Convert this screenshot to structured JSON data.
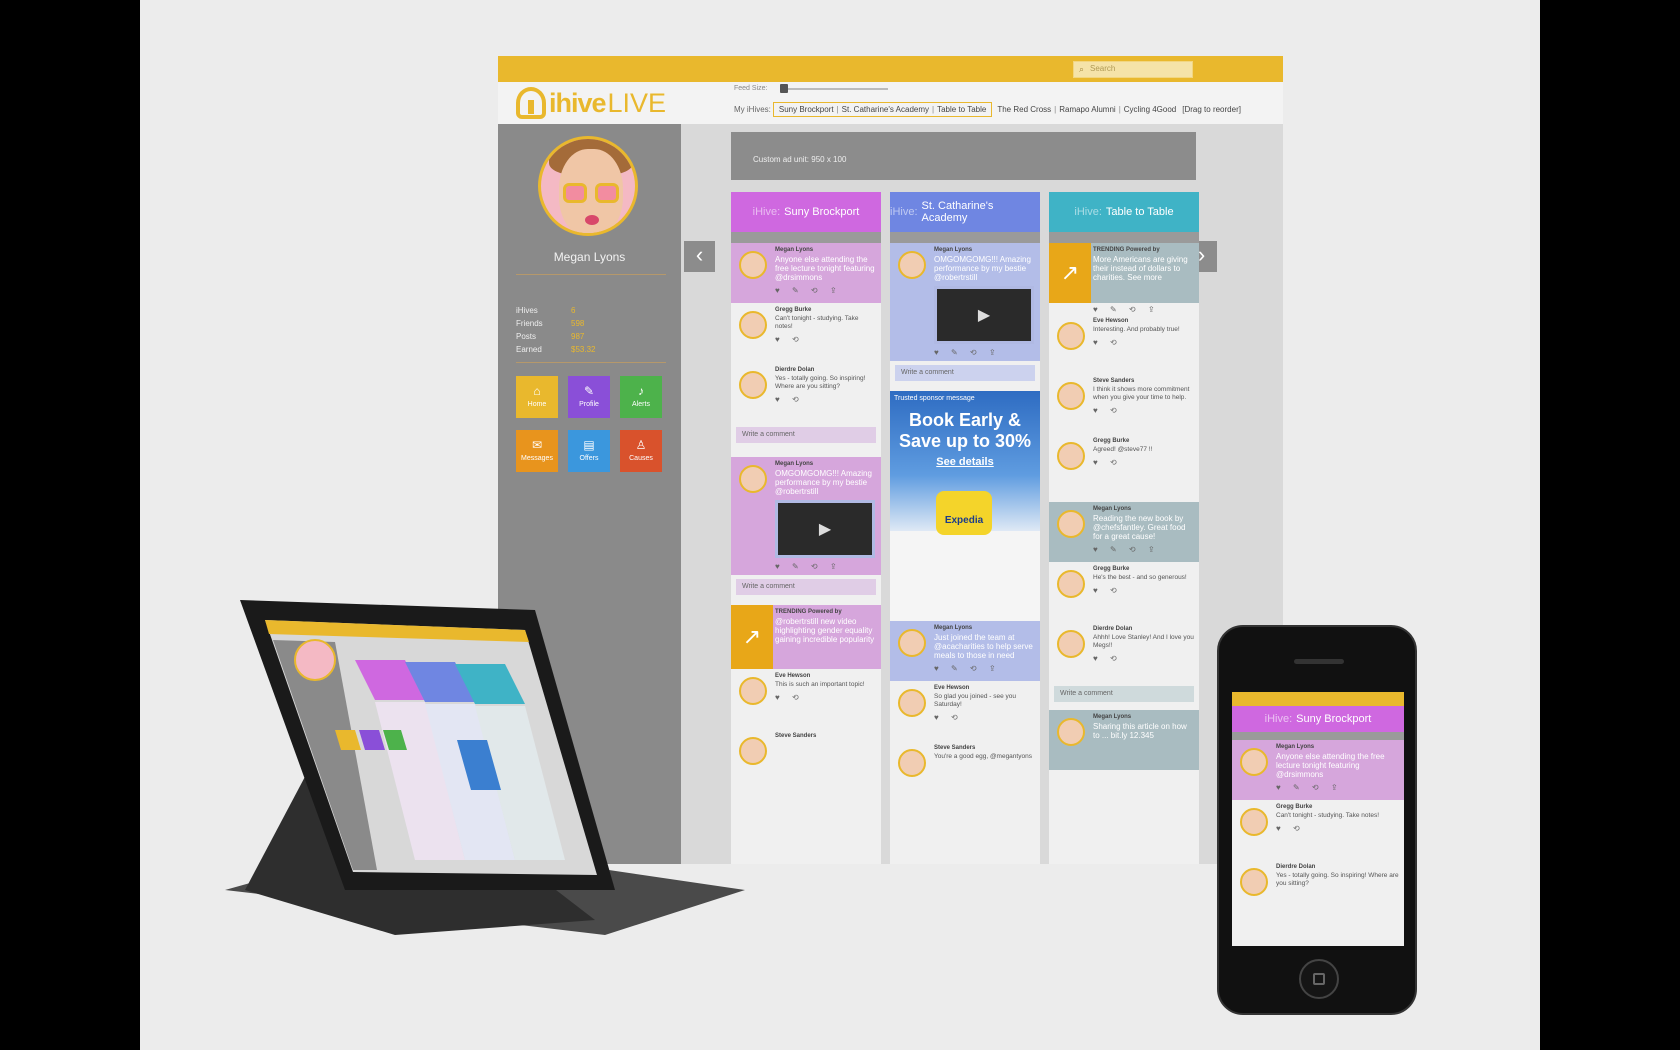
{
  "app": {
    "logo_brand": "ihive",
    "logo_live": "LIVE"
  },
  "search": {
    "placeholder": "Search"
  },
  "feed_size_label": "Feed Size:",
  "my_hives": {
    "label": "My iHives:",
    "selected": [
      "Suny Brockport",
      "St. Catharine's Academy",
      "Table to Table"
    ],
    "others": [
      "The Red Cross",
      "Ramapo Alumni",
      "Cycling 4Good"
    ],
    "hint": "[Drag to reorder]"
  },
  "profile": {
    "name": "Megan Lyons",
    "stats": [
      {
        "label": "iHives",
        "value": "6"
      },
      {
        "label": "Friends",
        "value": "598"
      },
      {
        "label": "Posts",
        "value": "987"
      },
      {
        "label": "Earned",
        "value": "$53.32"
      }
    ],
    "tiles": [
      {
        "label": "Home",
        "icon": "home-icon",
        "color": "#e9b82d"
      },
      {
        "label": "Profile",
        "icon": "wrench-icon",
        "color": "#8a4fd8"
      },
      {
        "label": "Alerts",
        "icon": "bell-icon",
        "color": "#4db24b"
      },
      {
        "label": "Messages",
        "icon": "envelope-icon",
        "color": "#e8941d"
      },
      {
        "label": "Offers",
        "icon": "clipboard-icon",
        "color": "#3b97dd"
      },
      {
        "label": "Causes",
        "icon": "ribbon-icon",
        "color": "#d9522c"
      }
    ]
  },
  "ad_unit": "Custom ad unit: 950 x 100",
  "columns": [
    {
      "prefix": "iHive:",
      "name": "Suny Brockport",
      "color": "#cf68e0"
    },
    {
      "prefix": "iHive:",
      "name": "St. Catharine's Academy",
      "color": "#6f86e2"
    },
    {
      "prefix": "iHive:",
      "name": "Table to Table",
      "color": "#3fb3c6"
    }
  ],
  "col1": {
    "p1": {
      "name": "Megan Lyons",
      "text": "Anyone else attending the free lecture tonight featuring @drsimmons"
    },
    "p2": {
      "name": "Gregg Burke",
      "text": "Can't tonight - studying. Take notes!"
    },
    "p3": {
      "name": "Dierdre Dolan",
      "text": "Yes - totally going. So inspiring! Where are you sitting?"
    },
    "comment": "Write a comment",
    "p4": {
      "name": "Megan Lyons",
      "text": "OMGOMGOMG!!! Amazing performance by my bestie @robertrstill"
    },
    "comment2": "Write a comment",
    "p5": {
      "name": "TRENDING Powered by",
      "text": "@robertrstill new video highlighting gender equality gaining incredible popularity"
    },
    "p6": {
      "name": "Eve Hewson",
      "text": "This is such an important topic!"
    },
    "p7": {
      "name": "Steve Sanders"
    }
  },
  "col2": {
    "p1": {
      "name": "Megan Lyons",
      "text": "OMGOMGOMG!!! Amazing performance by my bestie @robertrstill"
    },
    "comment": "Write a comment",
    "sponsor": "Trusted sponsor message",
    "ad_line1": "Book Early &",
    "ad_line2": "Save up to 30%",
    "ad_link": "See details",
    "ad_brand": "Expedia",
    "p2": {
      "name": "Megan Lyons",
      "text": "Just joined the team at @acacharities to help serve meals to those in need"
    },
    "p3": {
      "name": "Eve Hewson",
      "text": "So glad you joined - see you Saturday!"
    },
    "p4": {
      "name": "Steve Sanders",
      "text": "You're a good egg, @megantyons"
    }
  },
  "col3": {
    "p1": {
      "name": "TRENDING Powered by",
      "text": "More Americans are giving their instead of dollars to charities. See more"
    },
    "p2": {
      "name": "Eve Hewson",
      "text": "Interesting. And probably true!"
    },
    "p3": {
      "name": "Steve Sanders",
      "text": "I think it shows more commitment when you give your time to help."
    },
    "p4": {
      "name": "Gregg Burke",
      "text": "Agreed! @steve77 !!"
    },
    "p5": {
      "name": "Megan Lyons",
      "text": "Reading the new book by @chefsfantley. Great food for a great cause!"
    },
    "p6": {
      "name": "Gregg Burke",
      "text": "He's the best - and so generous!"
    },
    "p7": {
      "name": "Dierdre Dolan",
      "text": "Ahhh! Love Stanley! And I love you Megs!!"
    },
    "comment": "Write a comment",
    "p8": {
      "name": "Megan Lyons",
      "text": "Sharing this article on how to ... bit.ly 12.345"
    }
  },
  "phone": {
    "hive": "iHive:",
    "hive_name": "Suny Brockport",
    "p1": {
      "name": "Megan Lyons",
      "text": "Anyone else attending the free lecture tonight featuring @drsimmons"
    },
    "p2": {
      "name": "Gregg Burke",
      "text": "Can't tonight - studying. Take notes!"
    },
    "p3": {
      "name": "Dierdre Dolan",
      "text": "Yes - totally going. So inspiring! Where are you sitting?"
    }
  }
}
